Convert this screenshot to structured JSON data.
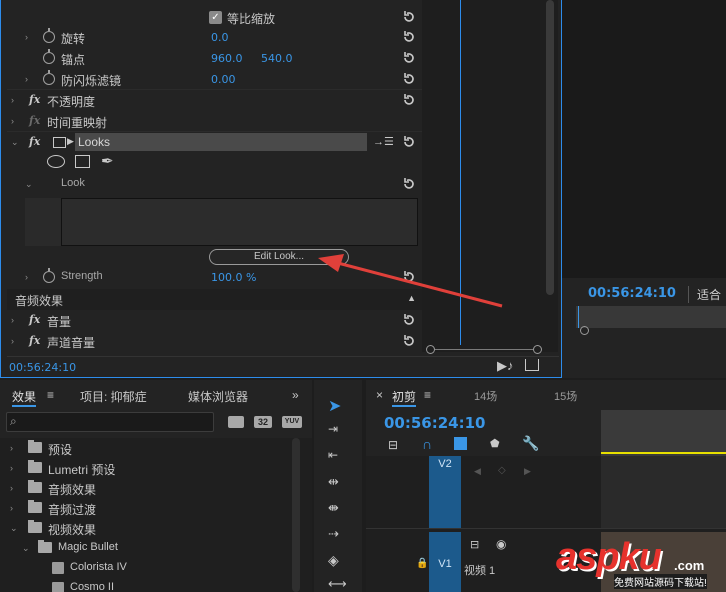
{
  "effect_controls": {
    "uniform_scale": {
      "label": "等比缩放",
      "checked": true
    },
    "rotation": {
      "label": "旋转",
      "value": "0.0"
    },
    "anchor": {
      "label": "锚点",
      "x": "960.0",
      "y": "540.0"
    },
    "flicker": {
      "label": "防闪烁滤镜",
      "value": "0.00"
    },
    "opacity": {
      "label": "不透明度"
    },
    "time_remap": {
      "label": "时间重映射"
    },
    "looks": {
      "name": "Looks",
      "look_label": "Look",
      "edit_button": "Edit Look...",
      "strength_label": "Strength",
      "strength_value": "100.0 %"
    },
    "audio_effects_header": "音频效果",
    "volume": {
      "label": "音量"
    },
    "channel_volume": {
      "label": "声道音量"
    },
    "timecode": "00:56:24:10",
    "fx_glyph": "fx"
  },
  "program_monitor": {
    "timecode": "00:56:24:10",
    "fit": "适合"
  },
  "effects_panel": {
    "tabs": [
      "效果",
      "项目: 抑郁症",
      "媒体浏览器"
    ],
    "badges": [
      "32",
      "YUV"
    ],
    "tree": [
      {
        "label": "预设"
      },
      {
        "label": "Lumetri 预设"
      },
      {
        "label": "音频效果"
      },
      {
        "label": "音频过渡"
      },
      {
        "label": "视频效果"
      },
      {
        "label": "Magic Bullet"
      },
      {
        "label": "Colorista IV"
      },
      {
        "label": "Cosmo II"
      }
    ]
  },
  "timeline": {
    "close": "×",
    "sequence": "初剪",
    "seq_tabs": [
      "14场",
      "15场"
    ],
    "timecode": "00:56:24:10",
    "tracks": [
      {
        "label": "V2"
      },
      {
        "label": "V1",
        "name": "视频 1"
      }
    ]
  },
  "watermark": {
    "text": "aspku",
    "suffix": ".com",
    "sub": "免费网站源码下载站!"
  },
  "colors": {
    "accent": "#3a96e6",
    "panel": "#232323",
    "arrow": "#e0403a"
  }
}
